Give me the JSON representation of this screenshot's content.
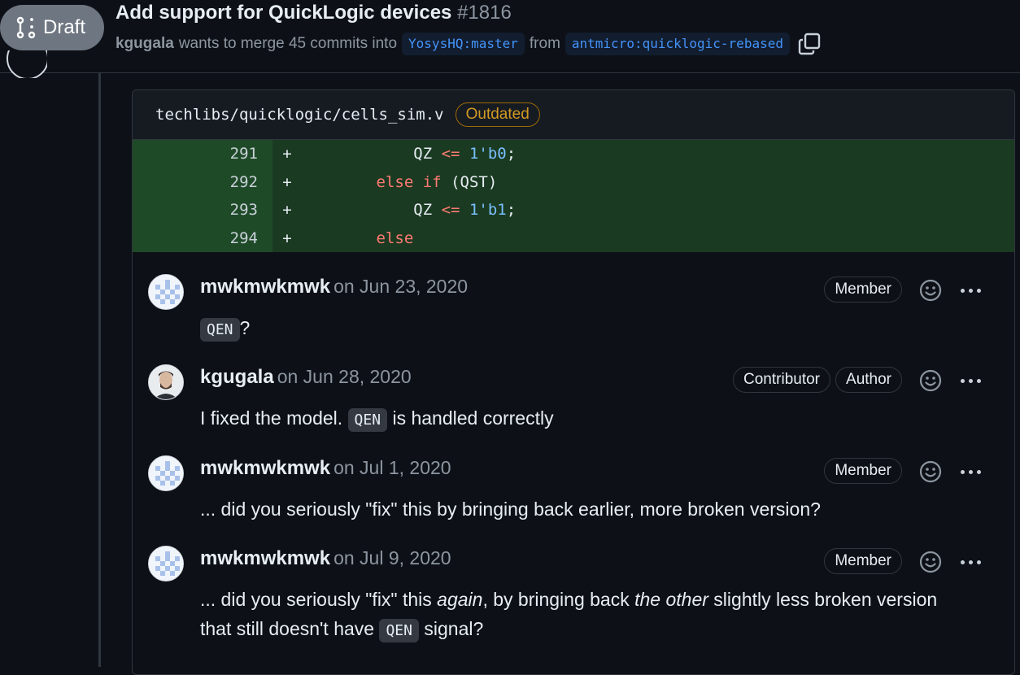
{
  "header": {
    "draft_label": "Draft",
    "title": "Add support for QuickLogic devices",
    "number": "#1816",
    "author": "kgugala",
    "merge_text": "wants to merge 45 commits into",
    "base_branch": "YosysHQ:master",
    "from_text": "from",
    "head_branch": "antmicro:quicklogic-rebased",
    "copy_icon": "copy-icon"
  },
  "thread": {
    "file_path": "techlibs/quicklogic/cells_sim.v",
    "outdated_label": "Outdated",
    "diff": [
      {
        "num": "291",
        "marker": "+",
        "indent": "            ",
        "tokens": [
          {
            "t": "QZ ",
            "c": ""
          },
          {
            "t": "<=",
            "c": "kw"
          },
          {
            "t": " ",
            "c": ""
          },
          {
            "t": "1'b0",
            "c": "num"
          },
          {
            "t": ";",
            "c": ""
          }
        ]
      },
      {
        "num": "292",
        "marker": "+",
        "indent": "        ",
        "tokens": [
          {
            "t": "else",
            "c": "kw"
          },
          {
            "t": " ",
            "c": ""
          },
          {
            "t": "if",
            "c": "kw"
          },
          {
            "t": " (QST)",
            "c": ""
          }
        ]
      },
      {
        "num": "293",
        "marker": "+",
        "indent": "            ",
        "tokens": [
          {
            "t": "QZ ",
            "c": ""
          },
          {
            "t": "<=",
            "c": "kw"
          },
          {
            "t": " ",
            "c": ""
          },
          {
            "t": "1'b1",
            "c": "num"
          },
          {
            "t": ";",
            "c": ""
          }
        ]
      },
      {
        "num": "294",
        "marker": "+",
        "indent": "        ",
        "tokens": [
          {
            "t": "else",
            "c": "kw"
          }
        ]
      }
    ]
  },
  "comments": [
    {
      "author": "mwkmwkmwk",
      "date": "on Jun 23, 2020",
      "badges": [
        "Member"
      ],
      "body": [
        {
          "code": "QEN"
        },
        {
          "text": "?"
        }
      ]
    },
    {
      "author": "kgugala",
      "date": "on Jun 28, 2020",
      "badges": [
        "Contributor",
        "Author"
      ],
      "body": [
        {
          "text": "I fixed the model. "
        },
        {
          "code": "QEN"
        },
        {
          "text": " is handled correctly"
        }
      ]
    },
    {
      "author": "mwkmwkmwk",
      "date": "on Jul 1, 2020",
      "badges": [
        "Member"
      ],
      "body": [
        {
          "text": "... did you seriously \"fix\" this by bringing back earlier, more broken version?"
        }
      ]
    },
    {
      "author": "mwkmwkmwk",
      "date": "on Jul 9, 2020",
      "badges": [
        "Member"
      ],
      "body": [
        {
          "text": "... did you seriously \"fix\" this "
        },
        {
          "em": "again"
        },
        {
          "text": ", by bringing back "
        },
        {
          "em": "the other"
        },
        {
          "text": " slightly less broken version"
        },
        {
          "br": true
        },
        {
          "text": "that still doesn't have "
        },
        {
          "code": "QEN"
        },
        {
          "text": " signal?"
        }
      ]
    }
  ],
  "icons": {
    "emoji": "smiley-icon",
    "more": "kebab-horizontal-icon",
    "pr_draft": "git-pull-request-draft-icon"
  }
}
